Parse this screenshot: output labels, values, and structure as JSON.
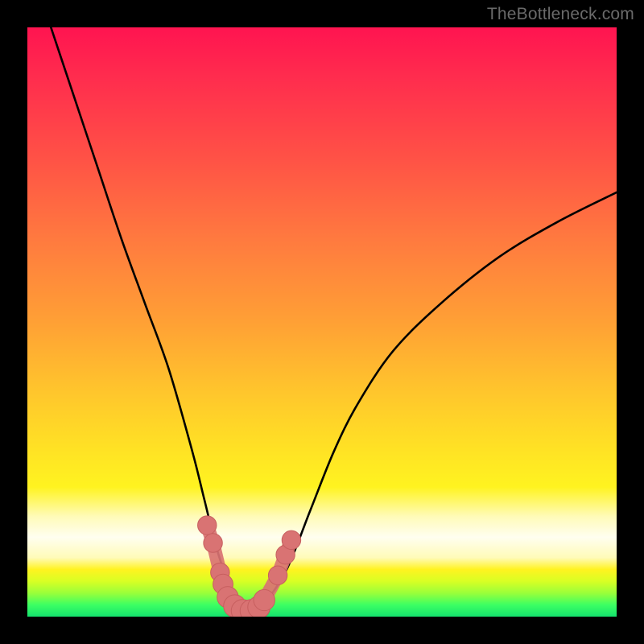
{
  "watermark": "TheBottleneck.com",
  "colors": {
    "frame": "#000000",
    "curve": "#000000",
    "marker_fill": "#d97373",
    "marker_stroke": "#c75f5f"
  },
  "chart_data": {
    "type": "line",
    "title": "",
    "xlabel": "",
    "ylabel": "",
    "xlim": [
      0,
      100
    ],
    "ylim": [
      0,
      100
    ],
    "grid": false,
    "series": [
      {
        "name": "bottleneck-curve",
        "x": [
          4,
          8,
          12,
          16,
          20,
          24,
          28,
          30,
          32,
          34,
          36,
          38,
          40,
          44,
          48,
          52,
          56,
          62,
          70,
          80,
          90,
          100
        ],
        "y": [
          100,
          88,
          76,
          64,
          53,
          42,
          28,
          20,
          12,
          6,
          2,
          1,
          2,
          8,
          18,
          28,
          36,
          45,
          53,
          61,
          67,
          72
        ]
      }
    ],
    "markers": [
      {
        "x": 30.5,
        "y": 15.5,
        "r": 1.6
      },
      {
        "x": 31.5,
        "y": 12.5,
        "r": 1.6
      },
      {
        "x": 32.7,
        "y": 7.5,
        "r": 1.6
      },
      {
        "x": 33.2,
        "y": 5.5,
        "r": 1.7
      },
      {
        "x": 34.0,
        "y": 3.3,
        "r": 1.8
      },
      {
        "x": 35.2,
        "y": 1.8,
        "r": 1.9
      },
      {
        "x": 36.5,
        "y": 1.0,
        "r": 1.9
      },
      {
        "x": 38.0,
        "y": 1.0,
        "r": 1.9
      },
      {
        "x": 39.3,
        "y": 1.6,
        "r": 1.9
      },
      {
        "x": 40.2,
        "y": 2.8,
        "r": 1.8
      },
      {
        "x": 42.5,
        "y": 7.0,
        "r": 1.6
      },
      {
        "x": 43.8,
        "y": 10.5,
        "r": 1.6
      },
      {
        "x": 44.8,
        "y": 13.0,
        "r": 1.6
      }
    ]
  }
}
